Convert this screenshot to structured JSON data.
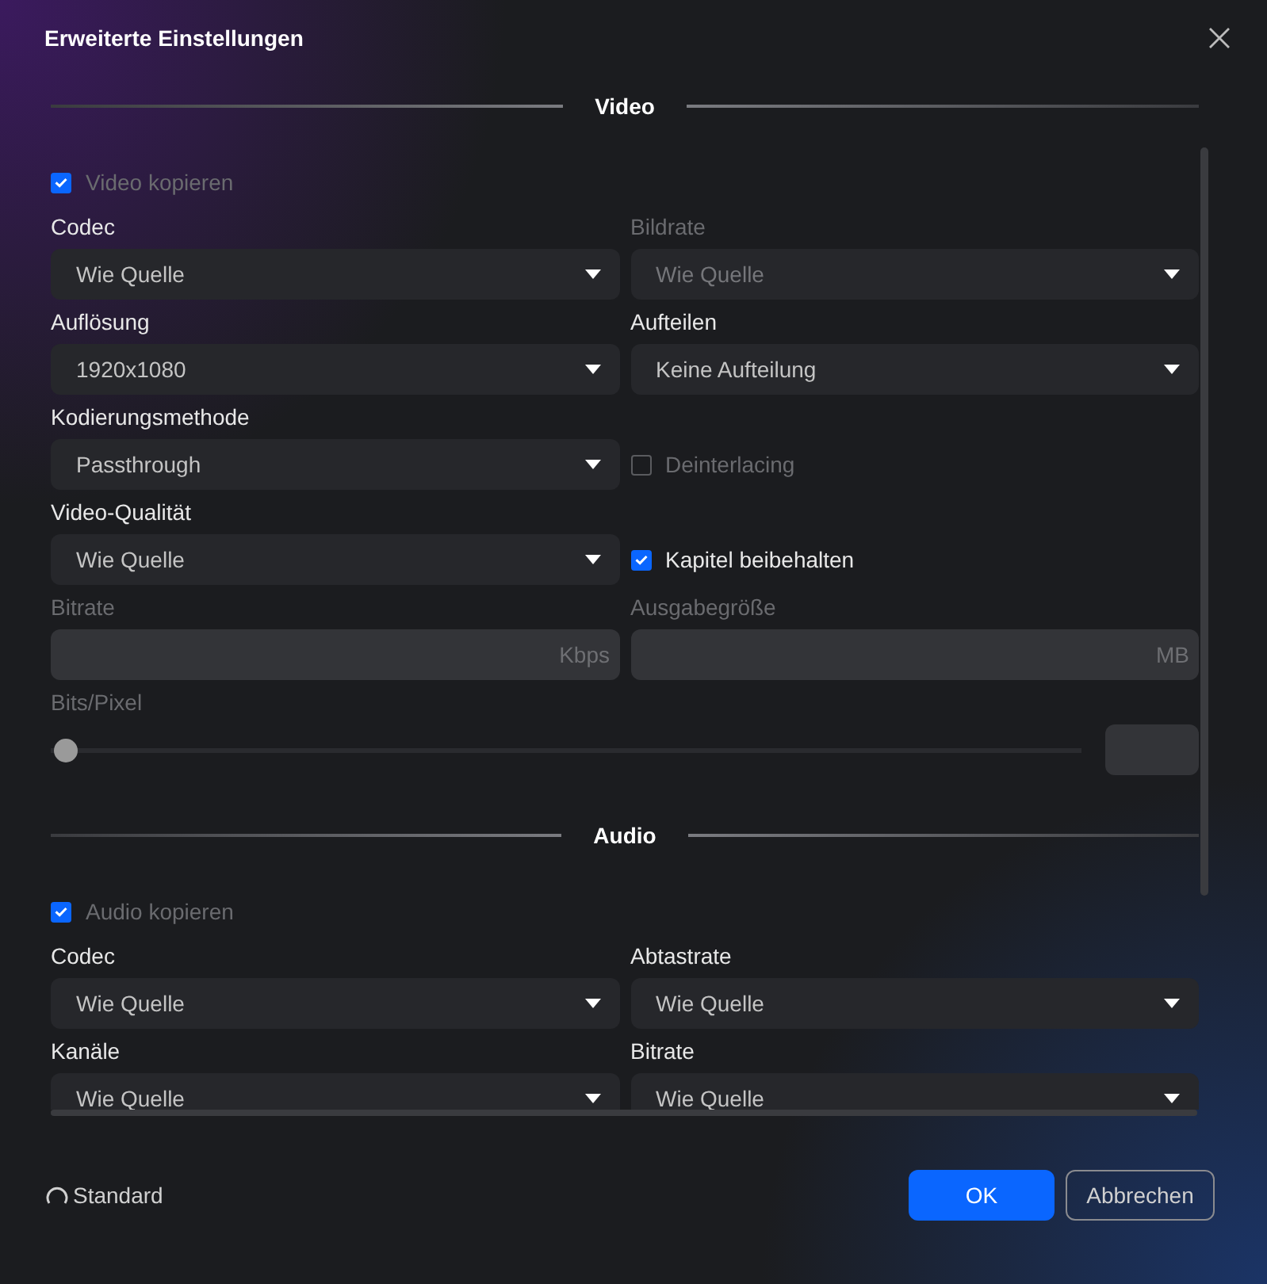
{
  "window": {
    "title": "Erweiterte Einstellungen"
  },
  "sections": [
    {
      "title": "Video",
      "toggle": {
        "label": "Video kopieren",
        "checked": true,
        "disabled": true
      },
      "fields": [
        {
          "kind": "select",
          "label": "Codec",
          "value": "Wie Quelle",
          "disabled": false
        },
        {
          "kind": "select",
          "label": "Bildrate",
          "value": "Wie Quelle",
          "disabled": true
        },
        {
          "kind": "select",
          "label": "Auflösung",
          "value": "1920x1080",
          "disabled": false
        },
        {
          "kind": "select",
          "label": "Aufteilen",
          "value": "Keine Aufteilung",
          "disabled": false
        },
        {
          "kind": "select",
          "label": "Kodierungsmethode",
          "value": "Passthrough",
          "disabled": false
        },
        {
          "kind": "checkbox",
          "label": "Deinterlacing",
          "checked": false,
          "disabled": true
        },
        {
          "kind": "select",
          "label": "Video-Qualität",
          "value": "Wie Quelle",
          "disabled": false
        },
        {
          "kind": "checkbox",
          "label": "Kapitel beibehalten",
          "checked": true,
          "disabled": false
        },
        {
          "kind": "input",
          "label": "Bitrate",
          "unit": "Kbps",
          "disabled": true
        },
        {
          "kind": "input",
          "label": "Ausgabegröße",
          "unit": "MB",
          "disabled": true
        }
      ],
      "slider": {
        "label": "Bits/Pixel",
        "level": 0,
        "disabled": true
      }
    },
    {
      "title": "Audio",
      "toggle": {
        "label": "Audio kopieren",
        "checked": true,
        "disabled": true
      },
      "fields": [
        {
          "kind": "select",
          "label": "Codec",
          "value": "Wie Quelle",
          "disabled": false
        },
        {
          "kind": "select",
          "label": "Abtastrate",
          "value": "Wie Quelle",
          "disabled": false
        },
        {
          "kind": "select",
          "label": "Kanäle",
          "value": "Wie Quelle",
          "disabled": false
        },
        {
          "kind": "select",
          "label": "Bitrate",
          "value": "Wie Quelle",
          "disabled": false
        }
      ]
    }
  ],
  "footer": {
    "reset": "Standard",
    "ok": "OK",
    "cancel": "Abbrechen"
  }
}
